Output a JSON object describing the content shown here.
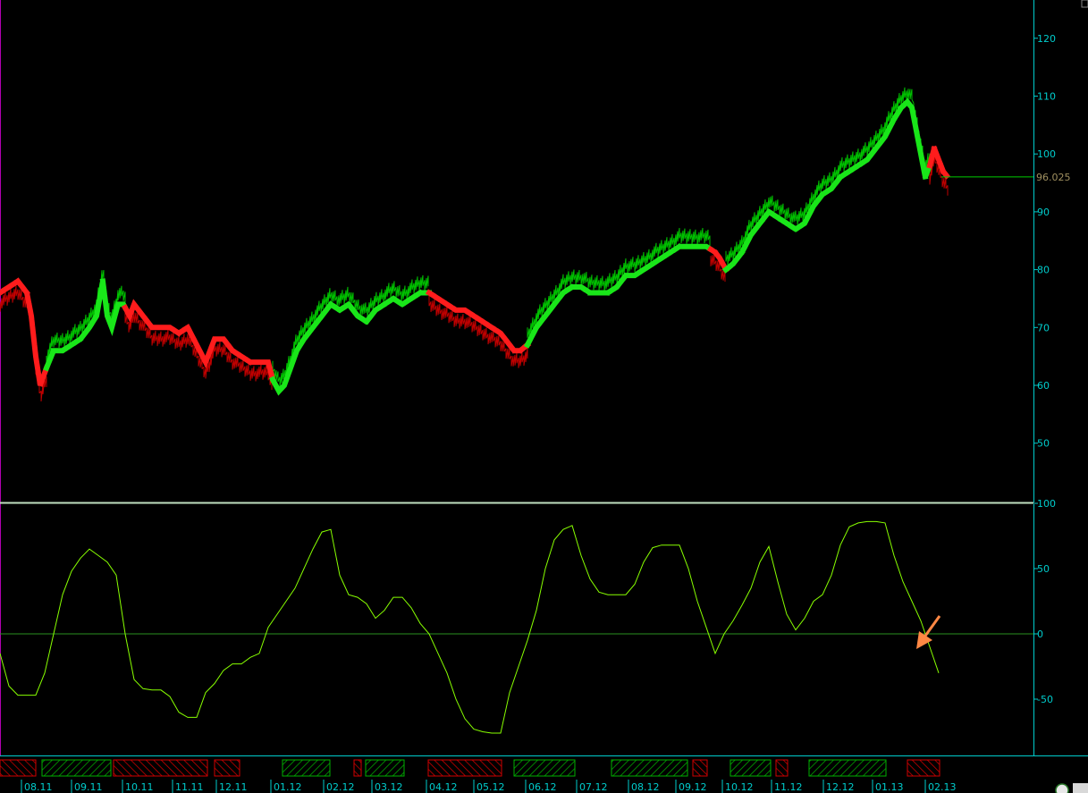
{
  "chart_data": [
    {
      "type": "line",
      "panel": "price",
      "ylim": [
        40,
        130
      ],
      "y_ticks": [
        "50",
        "60",
        "70",
        "80",
        "90",
        "100",
        "110",
        "120"
      ],
      "y_tick_values": [
        50,
        60,
        70,
        80,
        90,
        100,
        110,
        120
      ],
      "grid": false,
      "last_price": 96.025,
      "last_price_label": "96.025",
      "x_range": [
        0,
        1000
      ],
      "price_series": [
        [
          0,
          76
        ],
        [
          10,
          77
        ],
        [
          20,
          78
        ],
        [
          30,
          76
        ],
        [
          35,
          72
        ],
        [
          40,
          65
        ],
        [
          45,
          60
        ],
        [
          52,
          63
        ],
        [
          60,
          66
        ],
        [
          70,
          66
        ],
        [
          80,
          67
        ],
        [
          90,
          68
        ],
        [
          100,
          70
        ],
        [
          108,
          72
        ],
        [
          115,
          78
        ],
        [
          120,
          72
        ],
        [
          125,
          70
        ],
        [
          132,
          74
        ],
        [
          138,
          74
        ],
        [
          145,
          72
        ],
        [
          150,
          74
        ],
        [
          160,
          72
        ],
        [
          170,
          70
        ],
        [
          180,
          70
        ],
        [
          190,
          70
        ],
        [
          200,
          69
        ],
        [
          210,
          70
        ],
        [
          220,
          67
        ],
        [
          230,
          64
        ],
        [
          240,
          68
        ],
        [
          250,
          68
        ],
        [
          260,
          66
        ],
        [
          270,
          65
        ],
        [
          280,
          64
        ],
        [
          290,
          64
        ],
        [
          300,
          64
        ],
        [
          305,
          61
        ],
        [
          312,
          59
        ],
        [
          318,
          60
        ],
        [
          325,
          63
        ],
        [
          332,
          66
        ],
        [
          340,
          68
        ],
        [
          350,
          70
        ],
        [
          360,
          72
        ],
        [
          370,
          74
        ],
        [
          380,
          73
        ],
        [
          390,
          74
        ],
        [
          400,
          72
        ],
        [
          410,
          71
        ],
        [
          420,
          73
        ],
        [
          430,
          74
        ],
        [
          440,
          75
        ],
        [
          450,
          74
        ],
        [
          460,
          75
        ],
        [
          470,
          76
        ],
        [
          480,
          76
        ],
        [
          490,
          75
        ],
        [
          500,
          74
        ],
        [
          510,
          73
        ],
        [
          520,
          73
        ],
        [
          530,
          72
        ],
        [
          540,
          71
        ],
        [
          550,
          70
        ],
        [
          560,
          69
        ],
        [
          570,
          67
        ],
        [
          575,
          66
        ],
        [
          582,
          66
        ],
        [
          590,
          67
        ],
        [
          600,
          70
        ],
        [
          610,
          72
        ],
        [
          620,
          74
        ],
        [
          630,
          76
        ],
        [
          640,
          77
        ],
        [
          650,
          77
        ],
        [
          660,
          76
        ],
        [
          670,
          76
        ],
        [
          680,
          76
        ],
        [
          690,
          77
        ],
        [
          700,
          79
        ],
        [
          710,
          79
        ],
        [
          720,
          80
        ],
        [
          730,
          81
        ],
        [
          740,
          82
        ],
        [
          750,
          83
        ],
        [
          760,
          84
        ],
        [
          770,
          84
        ],
        [
          780,
          84
        ],
        [
          790,
          84
        ],
        [
          800,
          83
        ],
        [
          805,
          82
        ],
        [
          812,
          80
        ],
        [
          820,
          81
        ],
        [
          830,
          83
        ],
        [
          840,
          86
        ],
        [
          850,
          88
        ],
        [
          860,
          90
        ],
        [
          870,
          89
        ],
        [
          880,
          88
        ],
        [
          890,
          87
        ],
        [
          900,
          88
        ],
        [
          910,
          91
        ],
        [
          920,
          93
        ],
        [
          930,
          94
        ],
        [
          940,
          96
        ],
        [
          950,
          97
        ],
        [
          960,
          98
        ],
        [
          970,
          99
        ],
        [
          980,
          101
        ],
        [
          990,
          103
        ],
        [
          1000,
          106
        ],
        [
          1008,
          108
        ],
        [
          1015,
          109
        ],
        [
          1020,
          108
        ],
        [
          1025,
          104
        ],
        [
          1030,
          100
        ],
        [
          1035,
          96
        ],
        [
          1040,
          98
        ],
        [
          1045,
          101
        ],
        [
          1050,
          99
        ],
        [
          1055,
          97
        ],
        [
          1060,
          96
        ]
      ],
      "segments": [
        {
          "trend": "down",
          "from": 0,
          "to": 52
        },
        {
          "trend": "up",
          "from": 52,
          "to": 140
        },
        {
          "trend": "down",
          "from": 140,
          "to": 305
        },
        {
          "trend": "up",
          "from": 305,
          "to": 480
        },
        {
          "trend": "down",
          "from": 480,
          "to": 590
        },
        {
          "trend": "up",
          "from": 590,
          "to": 795
        },
        {
          "trend": "down",
          "from": 795,
          "to": 812
        },
        {
          "trend": "up",
          "from": 812,
          "to": 1040
        },
        {
          "trend": "down",
          "from": 1040,
          "to": 1060
        }
      ],
      "colors": {
        "up": "#00c000",
        "up_marker": "#19e619",
        "down": "#c00000",
        "down_marker": "#ff1c1c",
        "last_price_line": "#00cc00",
        "last_price_label": "#a09060"
      }
    },
    {
      "type": "line",
      "panel": "oscillator",
      "ylim": [
        -100,
        100
      ],
      "y_ticks": [
        "-50",
        "0",
        "50",
        "100"
      ],
      "y_tick_values": [
        -50,
        0,
        50,
        100
      ],
      "zero_line": 0,
      "values": [
        [
          0,
          -15
        ],
        [
          10,
          -40
        ],
        [
          20,
          -47
        ],
        [
          30,
          -47
        ],
        [
          40,
          -47
        ],
        [
          50,
          -30
        ],
        [
          60,
          0
        ],
        [
          70,
          30
        ],
        [
          80,
          48
        ],
        [
          90,
          58
        ],
        [
          100,
          65
        ],
        [
          110,
          60
        ],
        [
          120,
          55
        ],
        [
          130,
          45
        ],
        [
          140,
          0
        ],
        [
          150,
          -35
        ],
        [
          160,
          -42
        ],
        [
          170,
          -43
        ],
        [
          180,
          -43
        ],
        [
          190,
          -48
        ],
        [
          200,
          -60
        ],
        [
          210,
          -64
        ],
        [
          220,
          -64
        ],
        [
          230,
          -45
        ],
        [
          240,
          -38
        ],
        [
          250,
          -28
        ],
        [
          260,
          -23
        ],
        [
          270,
          -23
        ],
        [
          280,
          -18
        ],
        [
          290,
          -15
        ],
        [
          300,
          5
        ],
        [
          310,
          15
        ],
        [
          320,
          25
        ],
        [
          330,
          35
        ],
        [
          340,
          50
        ],
        [
          350,
          65
        ],
        [
          360,
          78
        ],
        [
          370,
          80
        ],
        [
          380,
          45
        ],
        [
          390,
          30
        ],
        [
          400,
          28
        ],
        [
          410,
          23
        ],
        [
          420,
          12
        ],
        [
          430,
          18
        ],
        [
          440,
          28
        ],
        [
          450,
          28
        ],
        [
          460,
          20
        ],
        [
          470,
          8
        ],
        [
          480,
          0
        ],
        [
          490,
          -15
        ],
        [
          500,
          -30
        ],
        [
          510,
          -50
        ],
        [
          520,
          -65
        ],
        [
          530,
          -73
        ],
        [
          540,
          -75
        ],
        [
          550,
          -76
        ],
        [
          560,
          -76
        ],
        [
          570,
          -45
        ],
        [
          580,
          -25
        ],
        [
          590,
          -5
        ],
        [
          600,
          18
        ],
        [
          610,
          50
        ],
        [
          620,
          72
        ],
        [
          630,
          80
        ],
        [
          640,
          83
        ],
        [
          650,
          60
        ],
        [
          660,
          42
        ],
        [
          670,
          32
        ],
        [
          680,
          30
        ],
        [
          690,
          30
        ],
        [
          700,
          30
        ],
        [
          710,
          38
        ],
        [
          720,
          55
        ],
        [
          730,
          66
        ],
        [
          740,
          68
        ],
        [
          750,
          68
        ],
        [
          760,
          68
        ],
        [
          770,
          50
        ],
        [
          780,
          25
        ],
        [
          790,
          5
        ],
        [
          800,
          -15
        ],
        [
          810,
          0
        ],
        [
          820,
          10
        ],
        [
          830,
          22
        ],
        [
          840,
          35
        ],
        [
          850,
          55
        ],
        [
          860,
          67
        ],
        [
          870,
          40
        ],
        [
          880,
          15
        ],
        [
          890,
          3
        ],
        [
          900,
          12
        ],
        [
          910,
          25
        ],
        [
          920,
          30
        ],
        [
          930,
          45
        ],
        [
          940,
          68
        ],
        [
          950,
          82
        ],
        [
          960,
          85
        ],
        [
          970,
          86
        ],
        [
          980,
          86
        ],
        [
          990,
          85
        ],
        [
          1000,
          60
        ],
        [
          1010,
          40
        ],
        [
          1020,
          25
        ],
        [
          1030,
          10
        ],
        [
          1040,
          -10
        ],
        [
          1050,
          -30
        ]
      ],
      "color": "#88ff00",
      "arrow_color": "#ff8844"
    }
  ],
  "x_labels": [
    "08.11",
    "09.11",
    "10.11",
    "11.11",
    "12.11",
    "01.12",
    "02.12",
    "03.12",
    "04.12",
    "05.12",
    "06.12",
    "07.12",
    "08.12",
    "09.12",
    "10.12",
    "11.12",
    "12.12",
    "01.13",
    "02.13"
  ],
  "bottom_bars": [
    {
      "state": "down",
      "from": 0,
      "to": 40
    },
    {
      "state": "up",
      "from": 47,
      "to": 124
    },
    {
      "state": "down",
      "from": 127,
      "to": 232
    },
    {
      "state": "down",
      "from": 240,
      "to": 268
    },
    {
      "state": "up",
      "from": 316,
      "to": 369
    },
    {
      "state": "down",
      "from": 396,
      "to": 404
    },
    {
      "state": "up",
      "from": 409,
      "to": 452
    },
    {
      "state": "down",
      "from": 479,
      "to": 561
    },
    {
      "state": "up",
      "from": 575,
      "to": 643
    },
    {
      "state": "up",
      "from": 684,
      "to": 769
    },
    {
      "state": "down",
      "from": 775,
      "to": 791
    },
    {
      "state": "up",
      "from": 817,
      "to": 862
    },
    {
      "state": "down",
      "from": 868,
      "to": 881
    },
    {
      "state": "up",
      "from": 905,
      "to": 991
    },
    {
      "state": "down",
      "from": 1015,
      "to": 1051
    }
  ],
  "colors": {
    "background": "#000000",
    "axis": "#00cccc",
    "separator": "#c0e0c0",
    "bar_up": "#00b000",
    "bar_down": "#d00000",
    "left_border": "#b000b0"
  }
}
